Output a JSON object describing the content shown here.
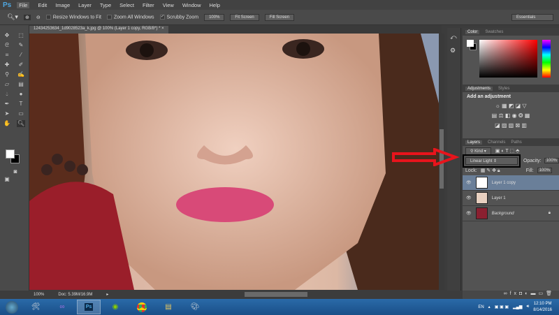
{
  "app": {
    "logo": "Ps"
  },
  "menu": [
    "File",
    "Edit",
    "Image",
    "Layer",
    "Type",
    "Select",
    "Filter",
    "View",
    "Window",
    "Help"
  ],
  "options": {
    "resize_windows": "Resize Windows to Fit",
    "zoom_all": "Zoom All Windows",
    "scrubby_zoom": "Scrubby Zoom",
    "btn_100": "100%",
    "fit_screen": "Fit Screen",
    "fill_screen": "Fill Screen",
    "workspace": "Essentials"
  },
  "document": {
    "tab_title": "12434253634_1d9028523a_k.jpg @ 100% (Layer 1 copy, RGB/8*) *",
    "close": "×"
  },
  "status": {
    "zoom": "100%",
    "doc": "Doc: 5.39M/16.9M"
  },
  "panels": {
    "color_tabs": [
      "Color",
      "Swatches"
    ],
    "adjust_tabs": [
      "Adjustments",
      "Styles"
    ],
    "add_adjustment": "Add an adjustment",
    "layer_tabs": [
      "Layers",
      "Channels",
      "Paths"
    ],
    "kind": "Kind",
    "blend_mode": "Linear Light",
    "opacity_label": "Opacity:",
    "opacity": "100%",
    "lock_label": "Lock:",
    "fill_label": "Fill:",
    "fill": "100%",
    "layers": [
      {
        "name": "Layer 1 copy",
        "selected": true
      },
      {
        "name": "Layer 1",
        "selected": false
      },
      {
        "name": "Background",
        "selected": false,
        "locked": true
      }
    ]
  },
  "annotation": {
    "arrow_color": "#e8141c",
    "box_color": "#000000"
  },
  "taskbar": {
    "lang": "EN",
    "time": "12:10 PM",
    "date": "8/14/2016",
    "apps": [
      "windows-start",
      "tools",
      "visual-studio",
      "photoshop",
      "coccoc",
      "chrome",
      "file-explorer",
      "paint"
    ]
  }
}
